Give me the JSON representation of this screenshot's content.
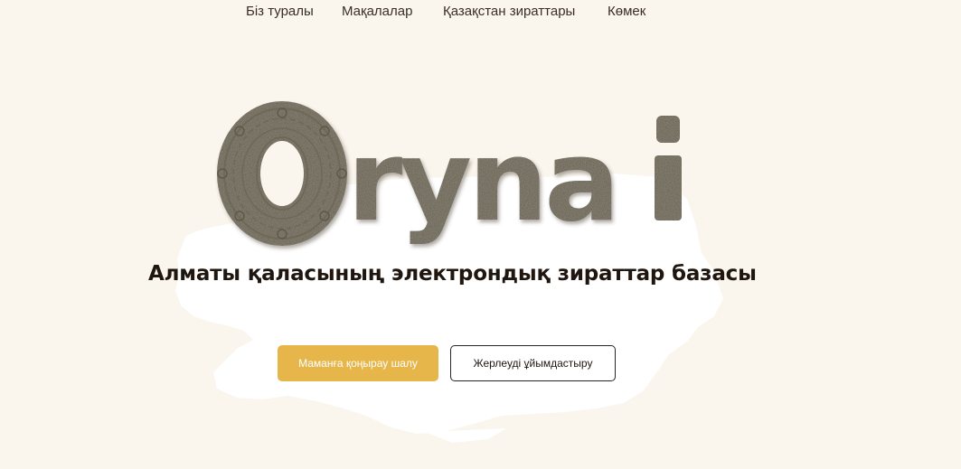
{
  "nav": {
    "items": [
      {
        "label": "Біз туралы"
      },
      {
        "label": "Мақалалар"
      },
      {
        "label": "Қазақстан зираттары"
      },
      {
        "label": "Көмек"
      }
    ]
  },
  "hero": {
    "logo_text": "Orynai",
    "subtitle": "Алматы қаласының электрондық зираттар базасы",
    "primary_button": "Маманға қоңырау шалу",
    "secondary_button": "Жерлеуді ұйымдастыру"
  },
  "colors": {
    "background": "#faf6ee",
    "accent": "#e6b64b",
    "stone": "#8a8474",
    "text": "#1f1610"
  },
  "icons": {
    "map": "kazakhstan-map-silhouette",
    "ornament": "kazakh-ornament-medallion"
  }
}
